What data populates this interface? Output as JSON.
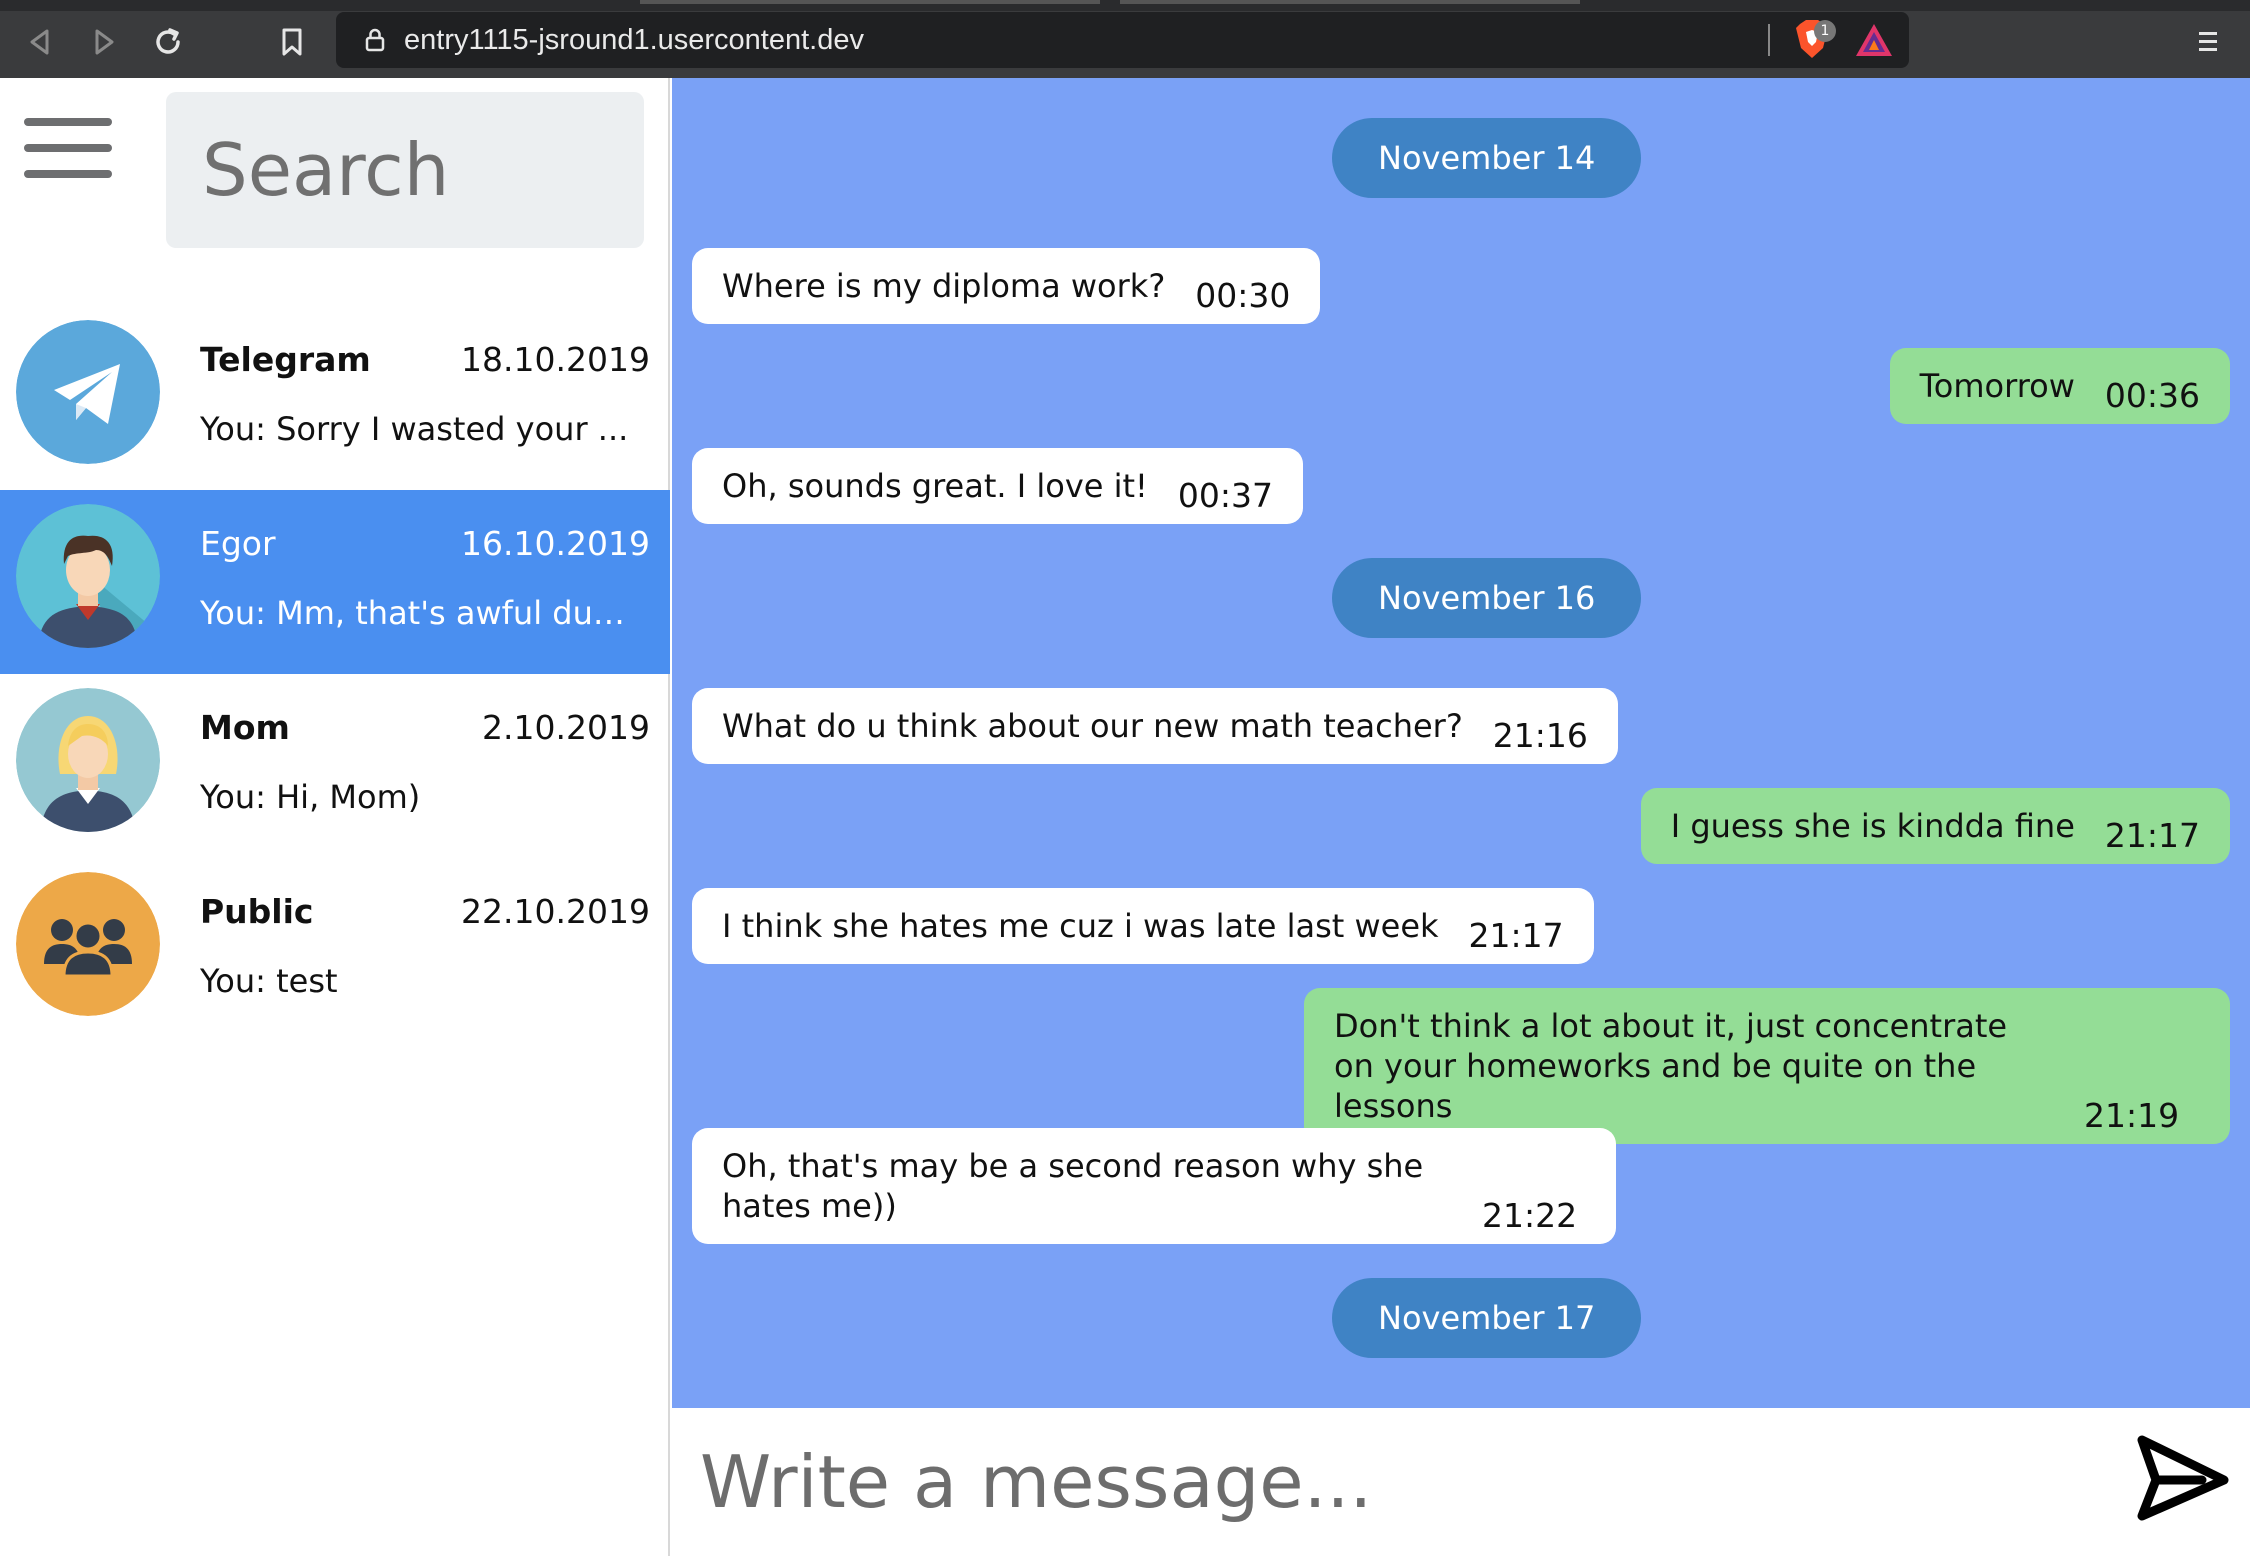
{
  "browser": {
    "url": "entry1115-jsround1.usercontent.dev",
    "shield_badge": "1"
  },
  "sidebar": {
    "search_placeholder": "Search",
    "chats": [
      {
        "name": "Telegram",
        "date": "18.10.2019",
        "preview": "You: Sorry I wasted your ...",
        "avatar": "telegram-logo-icon",
        "active": false
      },
      {
        "name": "Egor",
        "date": "16.10.2019",
        "preview": "You: Mm, that's awful dud...",
        "avatar": "man-avatar",
        "active": true
      },
      {
        "name": "Mom",
        "date": "2.10.2019",
        "preview": "You: Hi, Mom)",
        "avatar": "woman-avatar",
        "active": false
      },
      {
        "name": "Public",
        "date": "22.10.2019",
        "preview": "You: test",
        "avatar": "group-icon",
        "active": false
      }
    ]
  },
  "conversation": {
    "dates": [
      "November 14",
      "November 16",
      "November 17"
    ],
    "messages": [
      {
        "direction": "in",
        "text": "Where is my diploma work?",
        "time": "00:30"
      },
      {
        "direction": "out",
        "text": "Tomorrow",
        "time": "00:36"
      },
      {
        "direction": "in",
        "text": "Oh, sounds great. I love it!",
        "time": "00:37"
      },
      {
        "direction": "in",
        "text": "What do u think about our new math teacher?",
        "time": "21:16"
      },
      {
        "direction": "out",
        "text": "I guess she is kindda fine",
        "time": "21:17"
      },
      {
        "direction": "in",
        "text": "I think she hates me cuz i was late last week",
        "time": "21:17"
      },
      {
        "direction": "out",
        "text": "Don't think a lot about it, just concentrate on your homeworks and be quite on the lessons",
        "time": "21:19"
      },
      {
        "direction": "in",
        "text": "Oh, that's may be a second reason why she hates me))",
        "time": "21:22"
      }
    ]
  },
  "composer": {
    "placeholder": "Write a message..."
  },
  "colors": {
    "accent": "#4a8ff0",
    "conversation_bg": "#7aa1f6",
    "date_pill": "#3f83c5",
    "outgoing_bubble": "#94dd96",
    "incoming_bubble": "#ffffff"
  }
}
